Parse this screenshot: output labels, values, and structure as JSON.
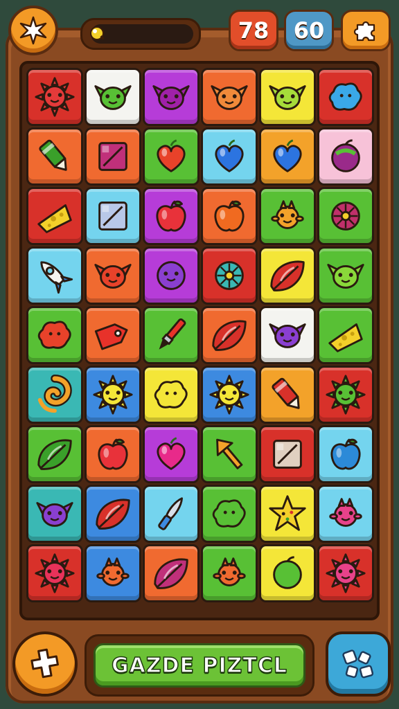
{
  "hud": {
    "moves": "78",
    "time": "60"
  },
  "footer": {
    "title": "GAZDE PIZTCL"
  },
  "colors": {
    "red": "#d8312a",
    "white": "#f4f4f0",
    "magenta": "#b63cd8",
    "orange": "#f06a30",
    "yellow": "#f4e638",
    "green": "#58c035",
    "amber": "#f3a22a",
    "pink": "#f7c2d8",
    "sky": "#74d4ee",
    "purple": "#8a3fd0",
    "blue": "#3d8ae0",
    "teal": "#3ab8b4"
  },
  "board": {
    "rows": [
      [
        {
          "bg": "red",
          "icon": "sun-face-icon",
          "color": "#e43a3a"
        },
        {
          "bg": "white",
          "icon": "goblin-face-icon",
          "color": "#58c035"
        },
        {
          "bg": "magenta",
          "icon": "goblin-face-icon",
          "color": "#a021a8"
        },
        {
          "bg": "orange",
          "icon": "goblin-face-icon",
          "color": "#f08a3a"
        },
        {
          "bg": "yellow",
          "icon": "goblin-face-icon",
          "color": "#a6dc3a"
        },
        {
          "bg": "red",
          "icon": "blob-icon",
          "color": "#3aa8e8"
        }
      ],
      [
        {
          "bg": "orange",
          "icon": "marker-icon",
          "color": "#3aa02a"
        },
        {
          "bg": "orange",
          "icon": "box-icon",
          "color": "#c0307a"
        },
        {
          "bg": "green",
          "icon": "heart-icon",
          "color": "#e8422a"
        },
        {
          "bg": "sky",
          "icon": "heart-icon",
          "color": "#2c74e0"
        },
        {
          "bg": "amber",
          "icon": "heart-icon",
          "color": "#2c74e0"
        },
        {
          "bg": "pink",
          "icon": "fruit-icon",
          "color": "#9a2a8a"
        }
      ],
      [
        {
          "bg": "red",
          "icon": "cheese-icon",
          "color": "#f4d02a"
        },
        {
          "bg": "sky",
          "icon": "box-icon",
          "color": "#b8c8e8"
        },
        {
          "bg": "magenta",
          "icon": "apple-icon",
          "color": "#e8323a"
        },
        {
          "bg": "orange",
          "icon": "apple-icon",
          "color": "#f06a20"
        },
        {
          "bg": "green",
          "icon": "critter-icon",
          "color": "#f3a22a"
        },
        {
          "bg": "green",
          "icon": "wheel-icon",
          "color": "#c0306a"
        }
      ],
      [
        {
          "bg": "sky",
          "icon": "rocket-icon",
          "color": "#f4f4f0"
        },
        {
          "bg": "orange",
          "icon": "goblin-face-icon",
          "color": "#e8422a"
        },
        {
          "bg": "magenta",
          "icon": "face-icon",
          "color": "#8a3fd0"
        },
        {
          "bg": "red",
          "icon": "wheel-icon",
          "color": "#3ab8b4"
        },
        {
          "bg": "yellow",
          "icon": "leaf-icon",
          "color": "#d8312a"
        },
        {
          "bg": "green",
          "icon": "goblin-face-icon",
          "color": "#8ad83a"
        }
      ],
      [
        {
          "bg": "green",
          "icon": "blob-icon",
          "color": "#e8422a"
        },
        {
          "bg": "orange",
          "icon": "tag-icon",
          "color": "#e8322a"
        },
        {
          "bg": "green",
          "icon": "brush-icon",
          "color": "#e8322a"
        },
        {
          "bg": "orange",
          "icon": "leaf-icon",
          "color": "#d8312a"
        },
        {
          "bg": "white",
          "icon": "goblin-face-icon",
          "color": "#8a3fd0"
        },
        {
          "bg": "green",
          "icon": "cheese-icon",
          "color": "#f4d02a"
        }
      ],
      [
        {
          "bg": "teal",
          "icon": "swirl-icon",
          "color": "#f3a22a"
        },
        {
          "bg": "blue",
          "icon": "sun-face-icon",
          "color": "#f4e638"
        },
        {
          "bg": "yellow",
          "icon": "blob-icon",
          "color": "#f4e638"
        },
        {
          "bg": "blue",
          "icon": "sun-face-icon",
          "color": "#f4e638"
        },
        {
          "bg": "amber",
          "icon": "marker-icon",
          "color": "#d8312a"
        },
        {
          "bg": "red",
          "icon": "sun-face-icon",
          "color": "#58c035"
        }
      ],
      [
        {
          "bg": "green",
          "icon": "leaf-icon",
          "color": "#3aa02a"
        },
        {
          "bg": "orange",
          "icon": "apple-icon",
          "color": "#e8323a"
        },
        {
          "bg": "magenta",
          "icon": "heart-icon",
          "color": "#e82a8a"
        },
        {
          "bg": "green",
          "icon": "arrow-icon",
          "color": "#f3a22a"
        },
        {
          "bg": "red",
          "icon": "box-icon",
          "color": "#e0d0c0"
        },
        {
          "bg": "sky",
          "icon": "apple-icon",
          "color": "#2c8ad8"
        }
      ],
      [
        {
          "bg": "teal",
          "icon": "goblin-face-icon",
          "color": "#8a3fd0"
        },
        {
          "bg": "blue",
          "icon": "leaf-icon",
          "color": "#d8312a"
        },
        {
          "bg": "sky",
          "icon": "knife-icon",
          "color": "#d8e0e8"
        },
        {
          "bg": "green",
          "icon": "blob-icon",
          "color": "#58c035"
        },
        {
          "bg": "yellow",
          "icon": "star-icon",
          "color": "#f4d02a"
        },
        {
          "bg": "sky",
          "icon": "critter-icon",
          "color": "#e8428a"
        }
      ],
      [
        {
          "bg": "red",
          "icon": "sun-face-icon",
          "color": "#e8325a"
        },
        {
          "bg": "blue",
          "icon": "critter-icon",
          "color": "#f06a30"
        },
        {
          "bg": "orange",
          "icon": "leaf-icon",
          "color": "#c0307a"
        },
        {
          "bg": "green",
          "icon": "critter-icon",
          "color": "#f06a30"
        },
        {
          "bg": "yellow",
          "icon": "fruit-icon",
          "color": "#58c035"
        },
        {
          "bg": "red",
          "icon": "sun-face-icon",
          "color": "#e8428a"
        }
      ]
    ]
  }
}
